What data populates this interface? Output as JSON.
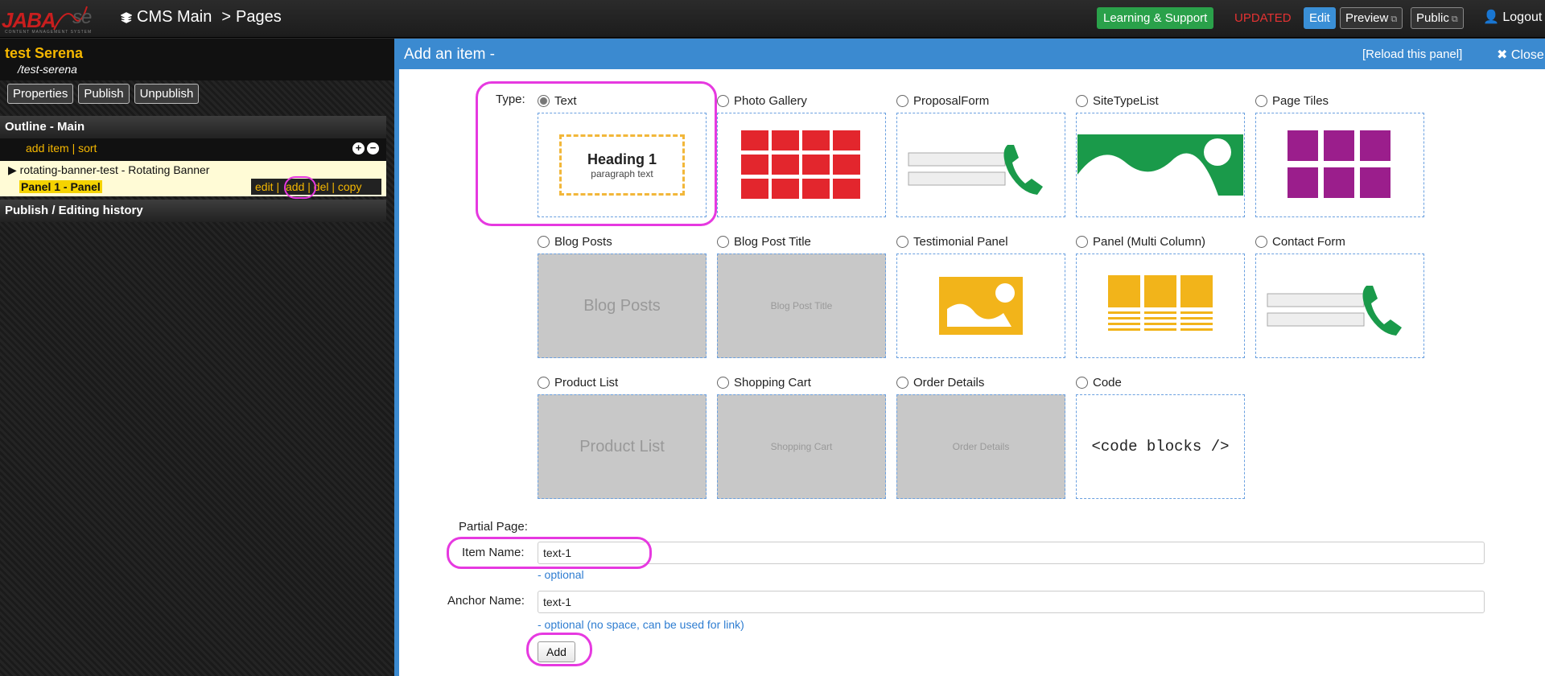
{
  "topbar": {
    "logo_text": "JABA",
    "logo_text2": "se",
    "logo_sub": "CONTENT MANAGEMENT SYSTEM",
    "crumb_root": "CMS Main",
    "crumb_sep": ">",
    "crumb_page": "Pages",
    "learning": "Learning & Support",
    "status": "UPDATED",
    "edit": "Edit",
    "preview": "Preview",
    "public": "Public",
    "logout": "Logout"
  },
  "left": {
    "title": "test Serena",
    "path": "/test-serena",
    "buttons": [
      "Properties",
      "Publish",
      "Unpublish"
    ],
    "outline_title": "Outline - Main",
    "add_sort": "add item | sort",
    "tree_item": "rotating-banner-test - Rotating Banner",
    "panel_item": "Panel 1 - Panel",
    "actions": {
      "edit": "edit",
      "add": "add",
      "del": "del",
      "copy": "copy"
    },
    "history_title": "Publish / Editing history"
  },
  "panel": {
    "title": "Add an item -",
    "reload": "[Reload this panel]",
    "close": "Close",
    "type_label": "Type:"
  },
  "types": [
    {
      "label": "Text",
      "selected": true,
      "thumb_heading": "Heading 1",
      "thumb_para": "paragraph text"
    },
    {
      "label": "Photo Gallery"
    },
    {
      "label": "ProposalForm"
    },
    {
      "label": "SiteTypeList"
    },
    {
      "label": "Page Tiles"
    },
    {
      "label": "Blog Posts",
      "thumb_text": "Blog Posts"
    },
    {
      "label": "Blog Post Title",
      "thumb_text": "Blog Post Title"
    },
    {
      "label": "Testimonial Panel"
    },
    {
      "label": "Panel (Multi Column)"
    },
    {
      "label": "Contact Form"
    },
    {
      "label": "Product List",
      "thumb_text": "Product List"
    },
    {
      "label": "Shopping Cart",
      "thumb_text": "Shopping Cart"
    },
    {
      "label": "Order Details",
      "thumb_text": "Order Details"
    },
    {
      "label": "Code",
      "thumb_text": "<code blocks />"
    }
  ],
  "form": {
    "partial_page": "Partial Page:",
    "item_name_label": "Item Name:",
    "item_name_value": "text-1",
    "item_hint": "- optional",
    "anchor_label": "Anchor Name:",
    "anchor_value": "text-1",
    "anchor_hint": "- optional (no space, can be used for link)",
    "add_button": "Add"
  },
  "colors": {
    "accent": "#3b8ad0",
    "highlight": "#e639e0",
    "brand_yellow": "#f5b700",
    "green": "#2aa14a",
    "red": "#e53232"
  }
}
